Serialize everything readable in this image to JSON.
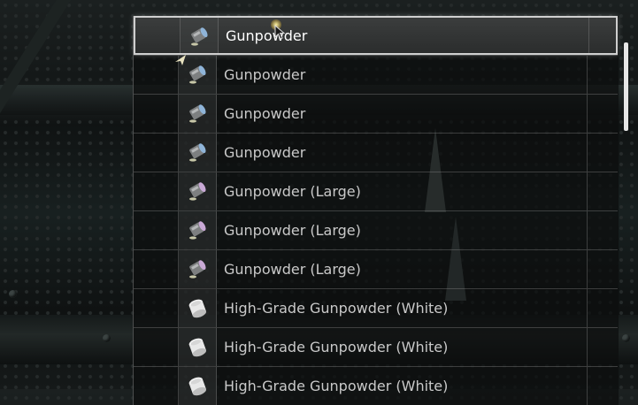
{
  "inventory": {
    "items": [
      {
        "name": "Gunpowder",
        "icon": "gunpowder-icon",
        "selected": true
      },
      {
        "name": "Gunpowder",
        "icon": "gunpowder-icon",
        "selected": false
      },
      {
        "name": "Gunpowder",
        "icon": "gunpowder-icon",
        "selected": false
      },
      {
        "name": "Gunpowder",
        "icon": "gunpowder-icon",
        "selected": false
      },
      {
        "name": "Gunpowder (Large)",
        "icon": "gunpowder-large-icon",
        "selected": false
      },
      {
        "name": "Gunpowder (Large)",
        "icon": "gunpowder-large-icon",
        "selected": false
      },
      {
        "name": "Gunpowder (Large)",
        "icon": "gunpowder-large-icon",
        "selected": false
      },
      {
        "name": "High-Grade Gunpowder (White)",
        "icon": "high-grade-gunpowder-white-icon",
        "selected": false
      },
      {
        "name": "High-Grade Gunpowder (White)",
        "icon": "high-grade-gunpowder-white-icon",
        "selected": false
      },
      {
        "name": "High-Grade Gunpowder (White)",
        "icon": "high-grade-gunpowder-white-icon",
        "selected": false
      }
    ]
  },
  "colors": {
    "gunpowder": "#8fb4d8",
    "gunpowder_large": "#c9a9d6",
    "high_grade_white": "#e8e8e8"
  }
}
